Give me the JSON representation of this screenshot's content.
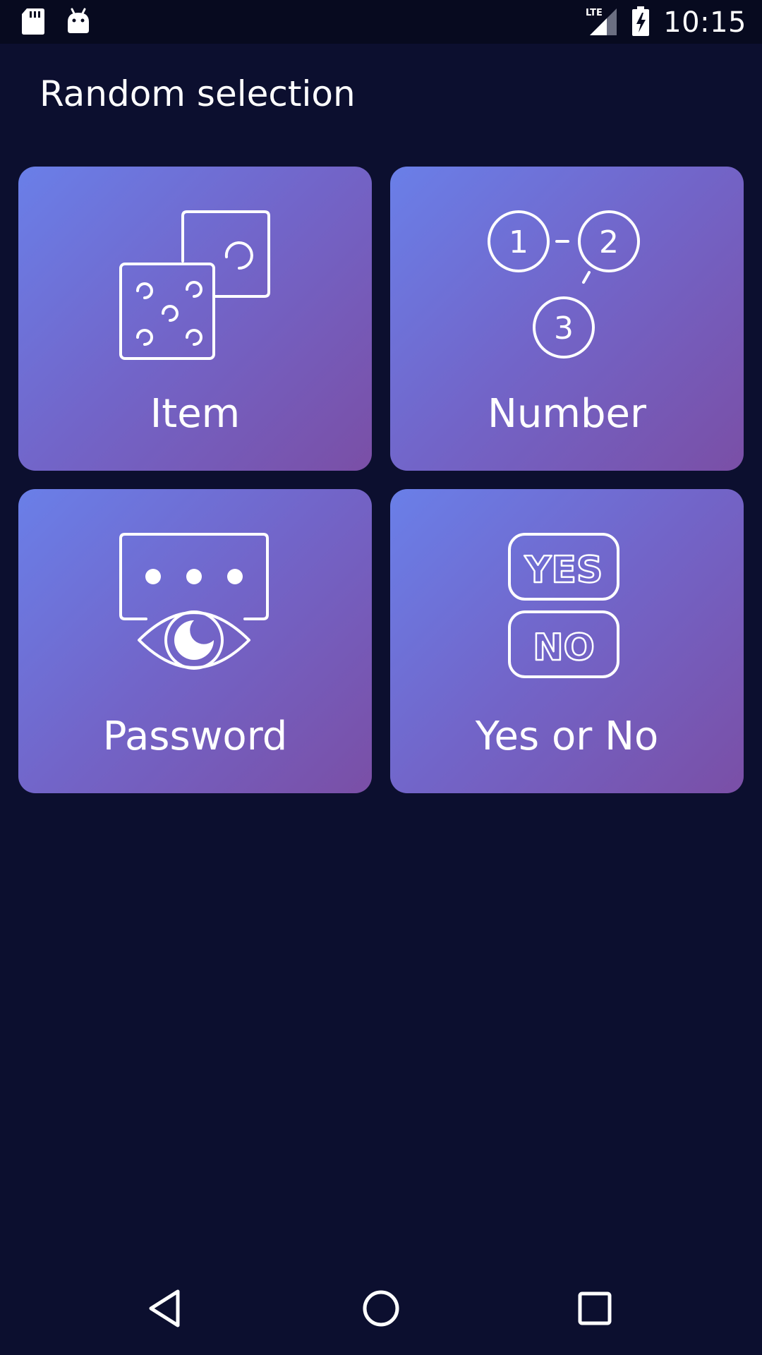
{
  "status_bar": {
    "time": "10:15",
    "left_icons": [
      "sd-card-icon",
      "android-debug-icon"
    ],
    "right_icons": [
      "lte-signal-icon",
      "battery-charging-icon"
    ],
    "network_label": "LTE"
  },
  "header": {
    "title": "Random selection"
  },
  "tiles": [
    {
      "label": "Item",
      "icon": "dice-icon"
    },
    {
      "label": "Number",
      "icon": "numbered-circles-icon"
    },
    {
      "label": "Password",
      "icon": "password-eye-icon"
    },
    {
      "label": "Yes or No",
      "icon": "yes-no-icon"
    }
  ],
  "nav_bar": {
    "buttons": [
      "back-icon",
      "home-icon",
      "recents-icon"
    ]
  },
  "colors": {
    "background": "#0c0f2f",
    "status_bar": "#070a1f",
    "tile_gradient_start": "#6a7fe8",
    "tile_gradient_end": "#7a4fa6",
    "foreground": "#ffffff"
  }
}
